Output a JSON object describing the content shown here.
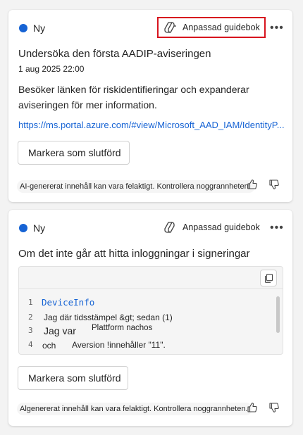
{
  "cards": [
    {
      "status": "Ny",
      "guide_label": "Anpassad guidebok",
      "title": "Undersöka den första AADIP-aviseringen",
      "timestamp": "1 aug 2025 22:00",
      "description": "Besöker länken för riskidentifieringar och expanderar aviseringen för mer information.",
      "link": "https://ms.portal.azure.com/#view/Microsoft_AAD_IAM/IdentityP...",
      "action_label": "Markera som slutförd",
      "ai_note": "AI-genererat innehåll kan vara felaktigt. Kontrollera noggrannheten."
    },
    {
      "status": "Ny",
      "guide_label": "Anpassad guidebok",
      "title": "Om det inte går att hitta inloggningar i signeringar",
      "code_lines": [
        {
          "no": "1",
          "text": "DeviceInfo"
        },
        {
          "no": "2",
          "text": "Jag där tidsstämpel &gt; sedan (1)"
        },
        {
          "no": "3",
          "text": "Jag var",
          "extra": "Plattform nachos"
        },
        {
          "no": "4",
          "text": "och",
          "extra": "Aversion !innehåller \"11\"."
        }
      ],
      "action_label": "Markera som slutförd",
      "ai_note": "Algenererat innehåll kan vara felaktigt. Kontrollera noggrannheten."
    }
  ],
  "colors": {
    "accent": "#1663d4",
    "highlight_border": "#d7141e",
    "background": "#f3f3f3"
  },
  "icons": {
    "guide": "copilot-icon",
    "more": "more-horizontal-icon",
    "copy": "copy-icon",
    "like": "thumbs-up-icon",
    "dislike": "thumbs-down-icon"
  }
}
